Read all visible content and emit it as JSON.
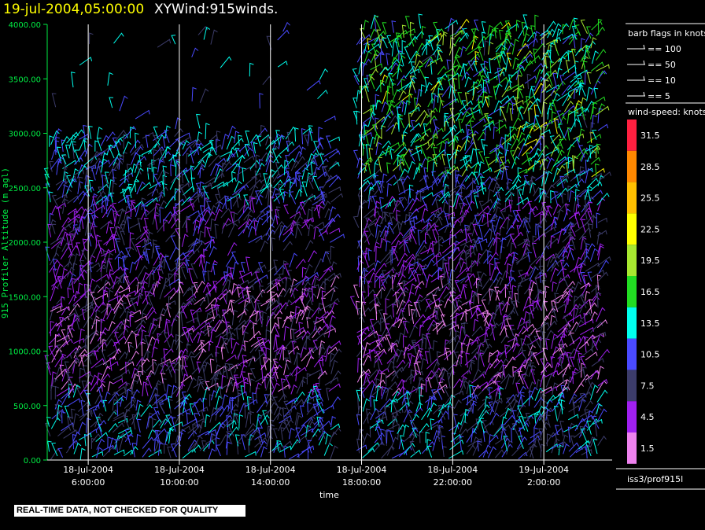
{
  "title": {
    "date": "19-jul-2004,05:00:00",
    "name": "XYWind:915winds."
  },
  "source_label": "iss3/prof915l",
  "banner": "REAL-TIME DATA, NOT CHECKED FOR QUALITY",
  "chart_data": {
    "type": "wind-barb",
    "xlabel": "time",
    "ylabel": "915 Profiler Altitude (m agl)",
    "ylim": [
      0,
      4000
    ],
    "yticks": [
      "0.00",
      "500.00",
      "1000.00",
      "1500.00",
      "2000.00",
      "2500.00",
      "3000.00",
      "3500.00",
      "4000.00"
    ],
    "xlim": [
      4.2,
      29.0
    ],
    "x_ticks": [
      {
        "hour": 6,
        "line1": "18-Jul-2004",
        "line2": "6:00:00"
      },
      {
        "hour": 10,
        "line1": "18-Jul-2004",
        "line2": "10:00:00"
      },
      {
        "hour": 14,
        "line1": "18-Jul-2004",
        "line2": "14:00:00"
      },
      {
        "hour": 18,
        "line1": "18-Jul-2004",
        "line2": "18:00:00"
      },
      {
        "hour": 22,
        "line1": "18-Jul-2004",
        "line2": "22:00:00"
      },
      {
        "hour": 26,
        "line1": "19-Jul-2004",
        "line2": "2:00:00"
      }
    ],
    "barb_legend": {
      "title": "barb flags in knots",
      "items": [
        "== 100",
        "== 50",
        "== 10",
        "== 5"
      ]
    },
    "speed_scale": {
      "title": "wind-speed: knots",
      "levels": [
        {
          "label": "31.5",
          "color": "#ff2040"
        },
        {
          "label": "28.5",
          "color": "#ff8800"
        },
        {
          "label": "25.5",
          "color": "#ffc000"
        },
        {
          "label": "22.5",
          "color": "#ffff00"
        },
        {
          "label": "19.5",
          "color": "#a8e830"
        },
        {
          "label": "16.5",
          "color": "#22dd22"
        },
        {
          "label": "13.5",
          "color": "#00ffee"
        },
        {
          "label": "10.5",
          "color": "#4a4aff"
        },
        {
          "label": "7.5",
          "color": "#3c3c6a"
        },
        {
          "label": "4.5",
          "color": "#a020f0"
        },
        {
          "label": "1.5",
          "color": "#ee82ee"
        }
      ]
    }
  }
}
